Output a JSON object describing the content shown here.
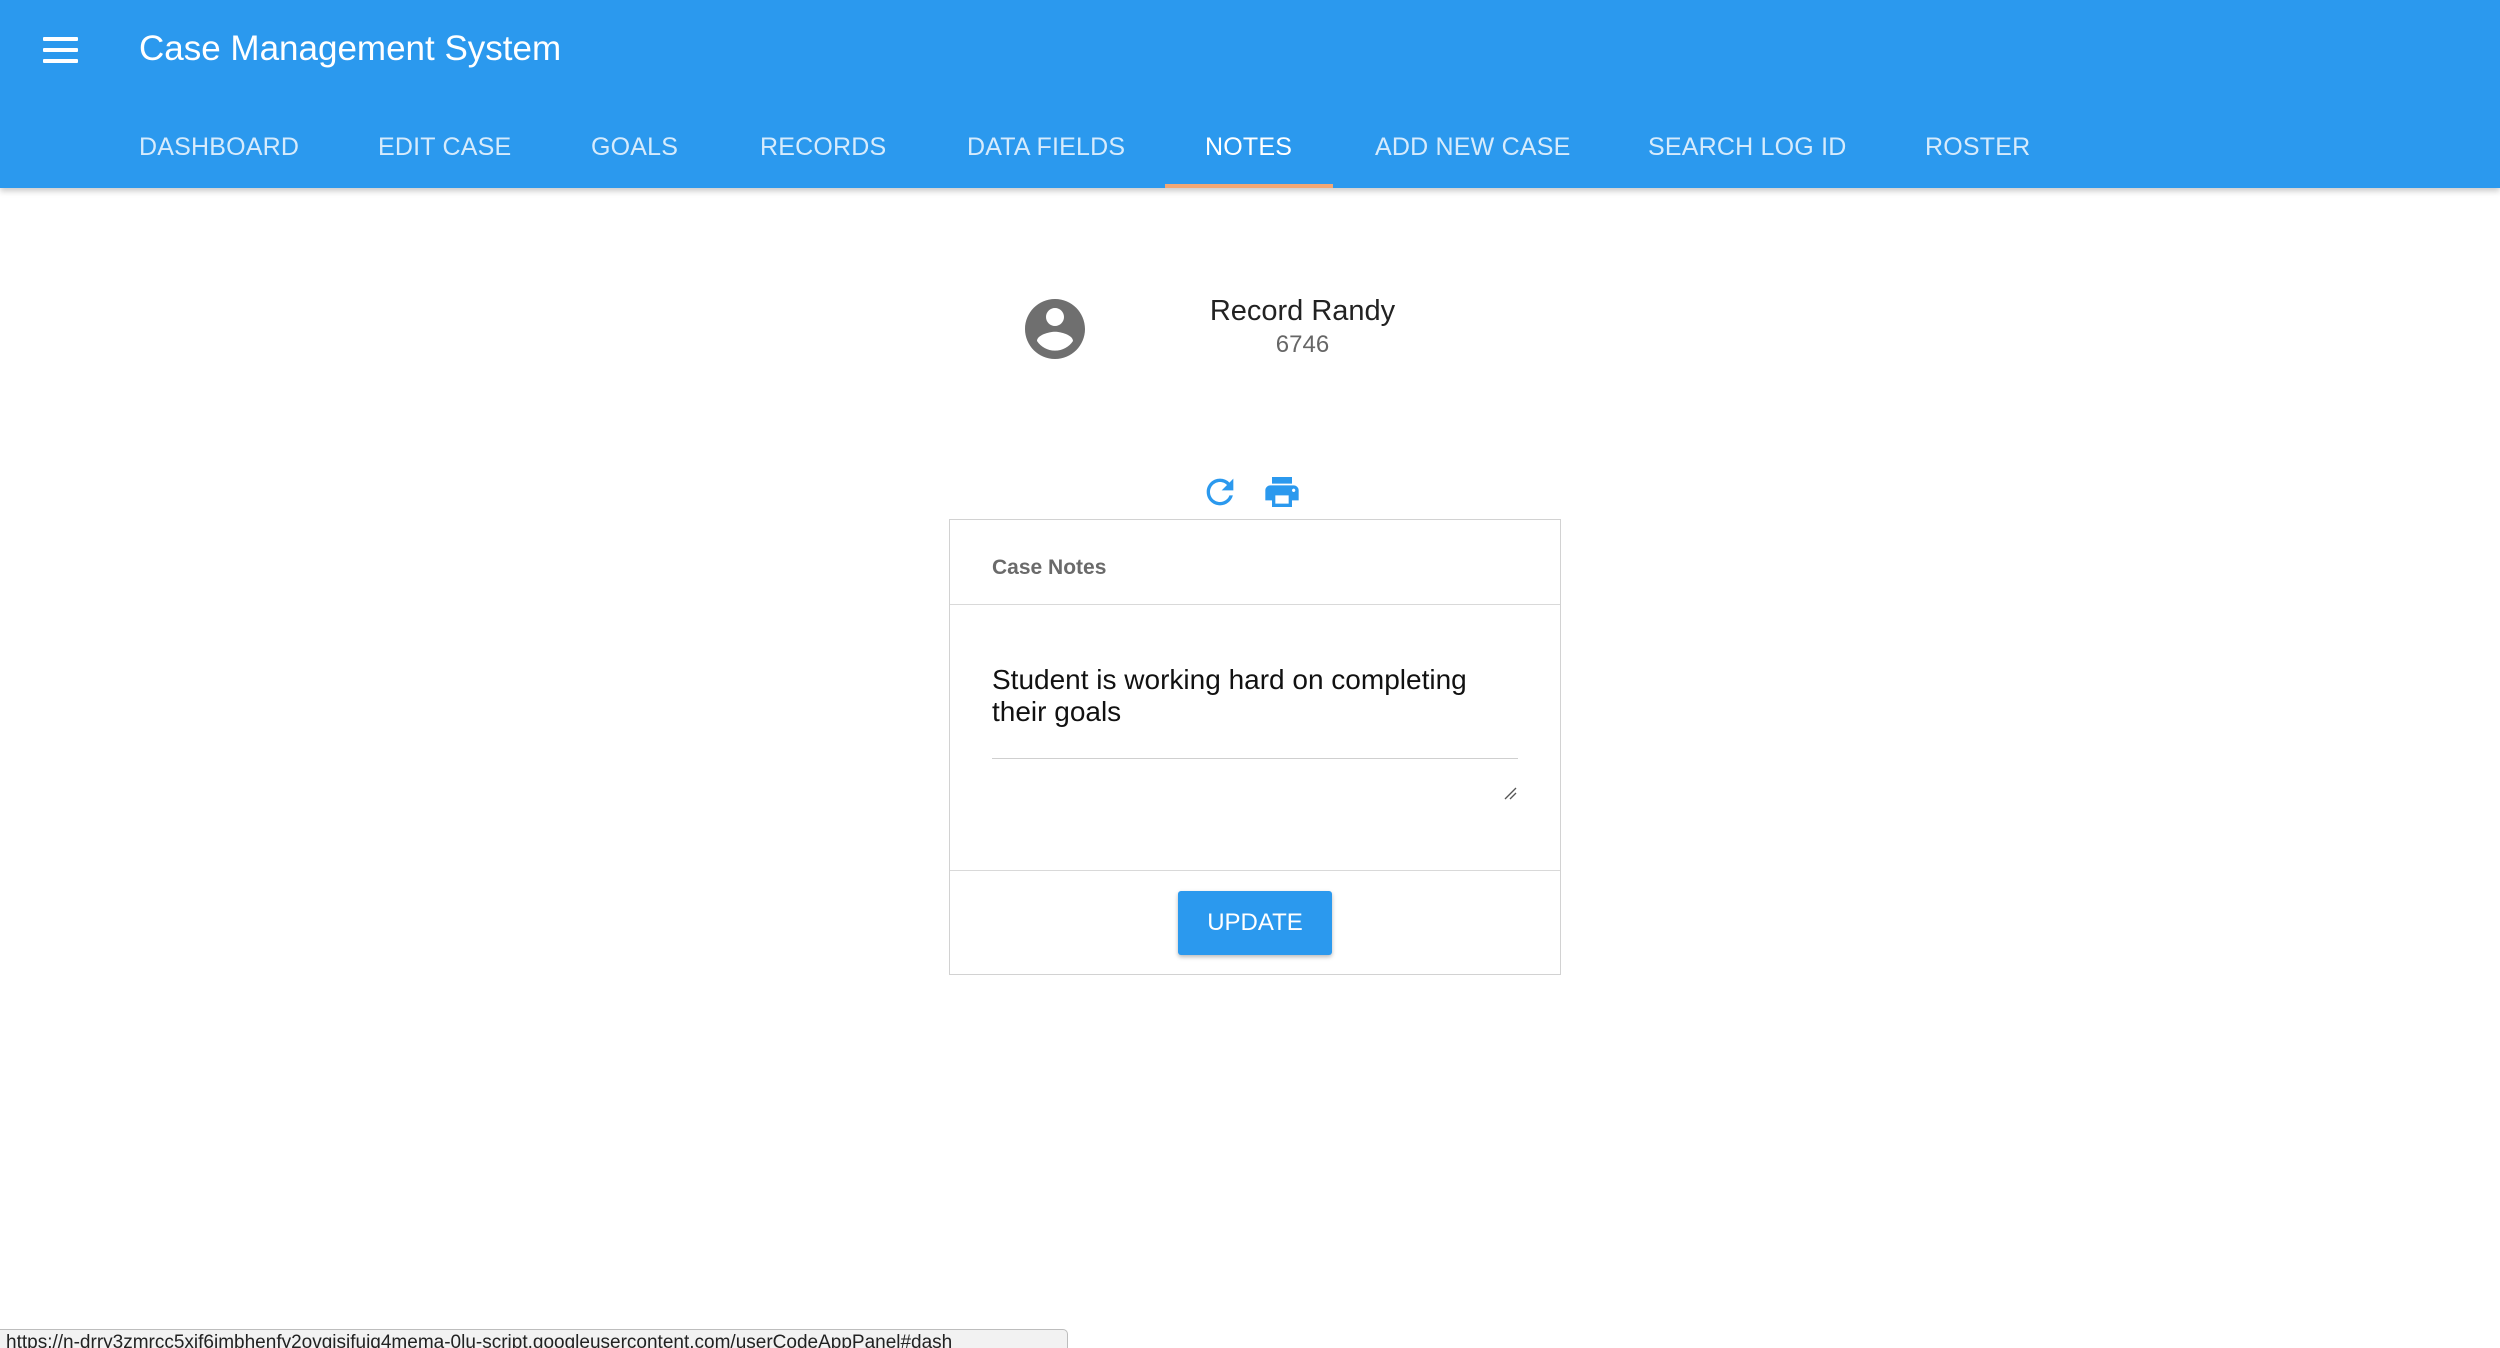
{
  "app": {
    "title": "Case Management System",
    "accent_color": "#2b99ee",
    "tab_indicator_color": "#f2a774"
  },
  "nav": {
    "menu_icon": "hamburger-menu-icon",
    "tabs": [
      {
        "label": "DASHBOARD",
        "active": false
      },
      {
        "label": "EDIT CASE",
        "active": false
      },
      {
        "label": "GOALS",
        "active": false
      },
      {
        "label": "RECORDS",
        "active": false
      },
      {
        "label": "DATA FIELDS",
        "active": false
      },
      {
        "label": "NOTES",
        "active": true
      },
      {
        "label": "ADD NEW CASE",
        "active": false
      },
      {
        "label": "SEARCH LOG ID",
        "active": false
      },
      {
        "label": "ROSTER",
        "active": false
      }
    ]
  },
  "profile": {
    "avatar_icon": "account-circle-icon",
    "name": "Record Randy",
    "id": "6746"
  },
  "toolbar": {
    "refresh_icon": "refresh-icon",
    "print_icon": "print-icon"
  },
  "card": {
    "title": "Case Notes",
    "notes_value": "Student is working hard on completing their goals",
    "update_label": "UPDATE"
  },
  "status_bar": {
    "url": "https://n-drry3zmrcc5xjf6imbhenfy2ovgisifuiq4mema-0lu-script.googleusercontent.com/userCodeAppPanel#dash"
  }
}
